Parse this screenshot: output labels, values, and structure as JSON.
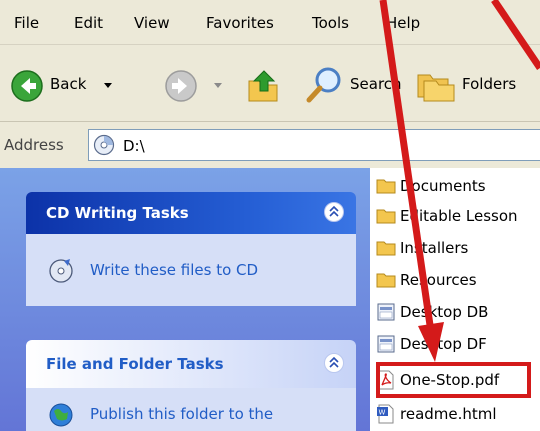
{
  "menu": [
    "File",
    "Edit",
    "View",
    "Favorites",
    "Tools",
    "Help"
  ],
  "toolbar": {
    "back_label": "Back",
    "search_label": "Search",
    "folders_label": "Folders"
  },
  "address": {
    "label": "Address",
    "value": "D:\\"
  },
  "task_pane": {
    "cd_tasks": {
      "title": "CD Writing Tasks",
      "link": "Write these files to CD"
    },
    "file_tasks": {
      "title": "File and Folder Tasks",
      "link": "Publish this folder to the"
    }
  },
  "files": [
    {
      "name": "Documents",
      "icon": "folder-icon"
    },
    {
      "name": "Editable Lesson",
      "icon": "folder-icon"
    },
    {
      "name": "Installers",
      "icon": "folder-icon"
    },
    {
      "name": "Resources",
      "icon": "folder-icon"
    },
    {
      "name": "Desktop DB",
      "icon": "system-file-icon"
    },
    {
      "name": "Desktop DF",
      "icon": "system-file-icon"
    },
    {
      "name": "One-Stop.pdf",
      "icon": "pdf-icon"
    },
    {
      "name": "readme.html",
      "icon": "html-file-icon"
    }
  ],
  "annotation_color": "#d41a1a"
}
